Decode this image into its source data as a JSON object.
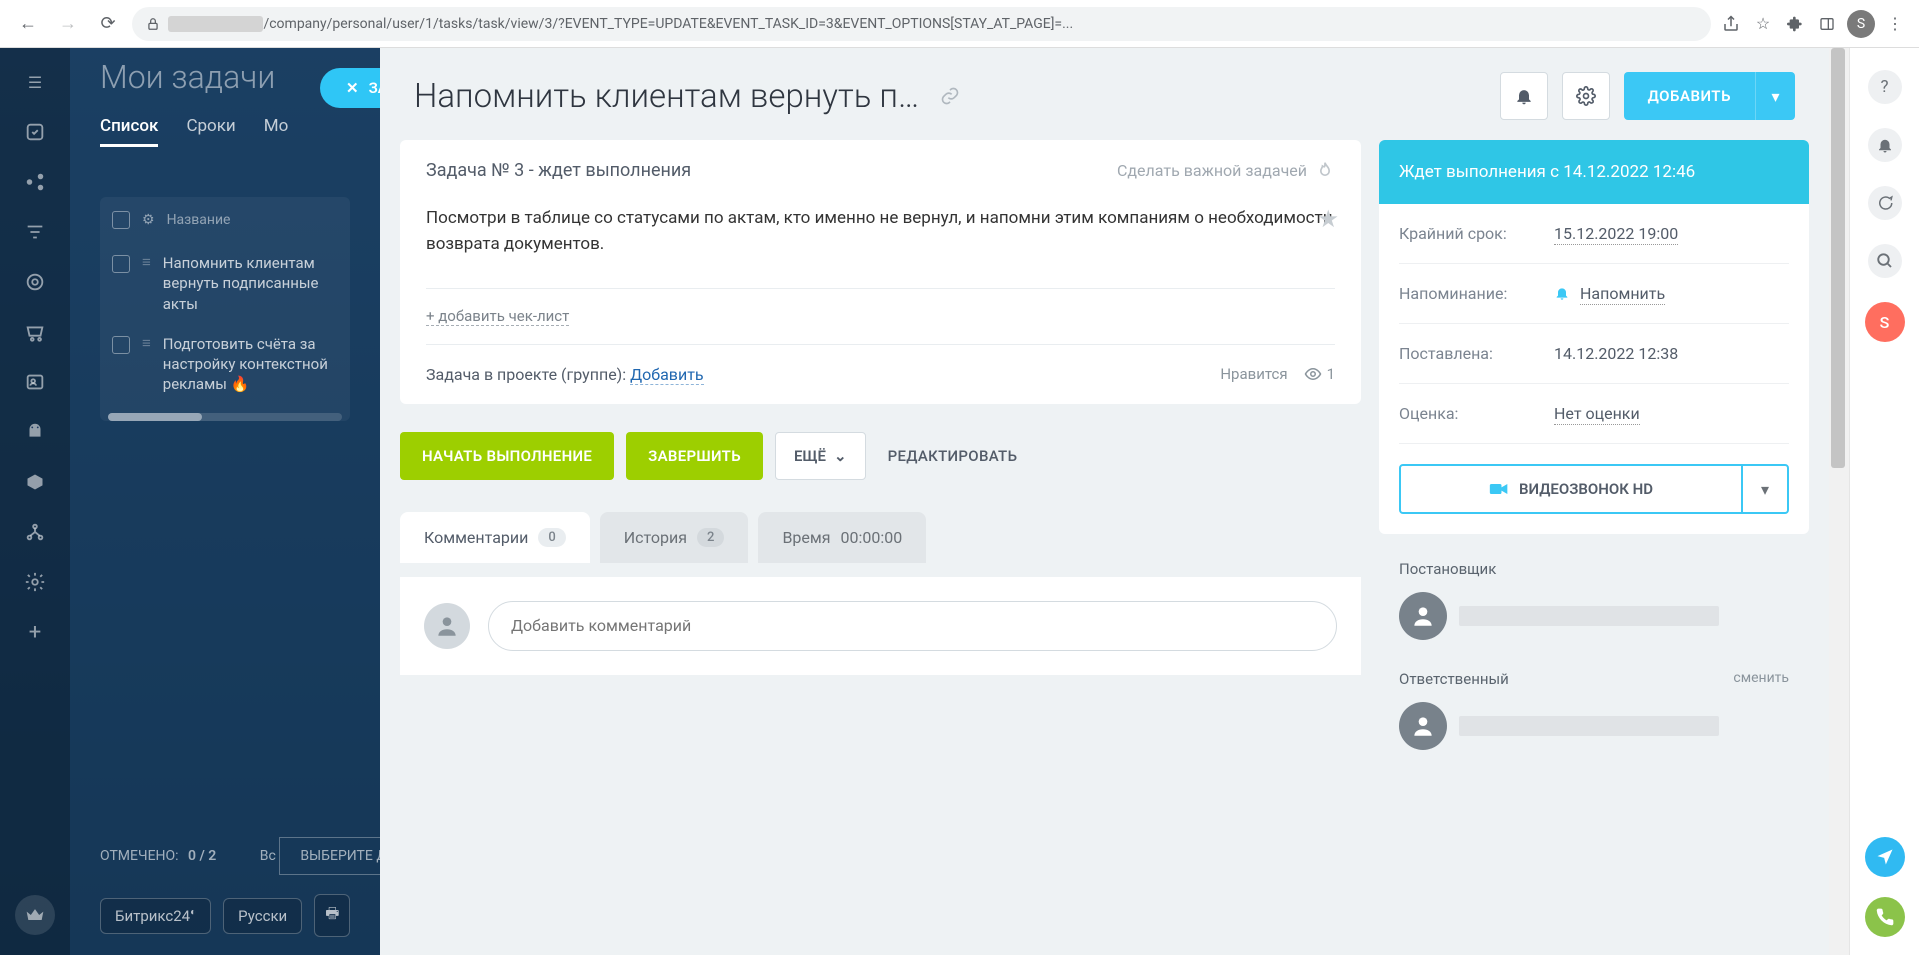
{
  "browser": {
    "url_masked_domain": "————————",
    "url_path": "/company/personal/user/1/tasks/task/view/3/?EVENT_TYPE=UPDATE&EVENT_TASK_ID=3&EVENT_OPTIONS[STAY_AT_PAGE]=...",
    "profile_letter": "S"
  },
  "background": {
    "page_title": "Мои задачи",
    "task_button": "ЗАДАЧА",
    "tabs": {
      "list": "Список",
      "deadlines": "Сроки",
      "more": "Мо"
    },
    "table": {
      "header": "Название",
      "rows": [
        "Напомнить клиентам вернуть подписанные акты",
        "Подготовить счёта за настройку контекстной рекламы"
      ]
    },
    "selected_label": "ОТМЕЧЕНО:",
    "selected_count": "0 / 2",
    "all_label": "Вс",
    "choose_action": "ВЫБЕРИТЕ ДЕЙСТВИЕ",
    "brand": "Битрикс24",
    "lang": "Русски"
  },
  "modal": {
    "title": "Напомнить клиентам вернуть подписанные акты",
    "add_button": "ДОБАВИТЬ",
    "task_number_line": "Задача № 3 - ждет выполнения",
    "make_important": "Сделать важной задачей",
    "description": "Посмотри в таблице со статусами по актам, кто именно не вернул, и напомни этим компаниям о необходимости возврата документов.",
    "add_checklist": "+ добавить чек-лист",
    "project_label": "Задача в проекте (группе):",
    "project_add": "Добавить",
    "like": "Нравится",
    "views": "1",
    "actions": {
      "start": "НАЧАТЬ ВЫПОЛНЕНИЕ",
      "finish": "ЗАВЕРШИТЬ",
      "more": "ЕЩЁ",
      "edit": "РЕДАКТИРОВАТЬ"
    },
    "tabs": {
      "comments": "Комментарии",
      "comments_count": "0",
      "history": "История",
      "history_count": "2",
      "time": "Время",
      "time_value": "00:00:00"
    },
    "comment_placeholder": "Добавить комментарий"
  },
  "sidebar": {
    "status": "Ждет выполнения с 14.12.2022 12:46",
    "rows": {
      "deadline_label": "Крайний срок:",
      "deadline_value": "15.12.2022 19:00",
      "remind_label": "Напоминание:",
      "remind_value": "Напомнить",
      "created_label": "Поставлена:",
      "created_value": "14.12.2022 12:38",
      "rating_label": "Оценка:",
      "rating_value": "Нет оценки"
    },
    "video_call": "ВИДЕОЗВОНОК HD",
    "creator_label": "Постановщик",
    "responsible_label": "Ответственный",
    "change": "сменить"
  },
  "right_rail_letter": "S"
}
